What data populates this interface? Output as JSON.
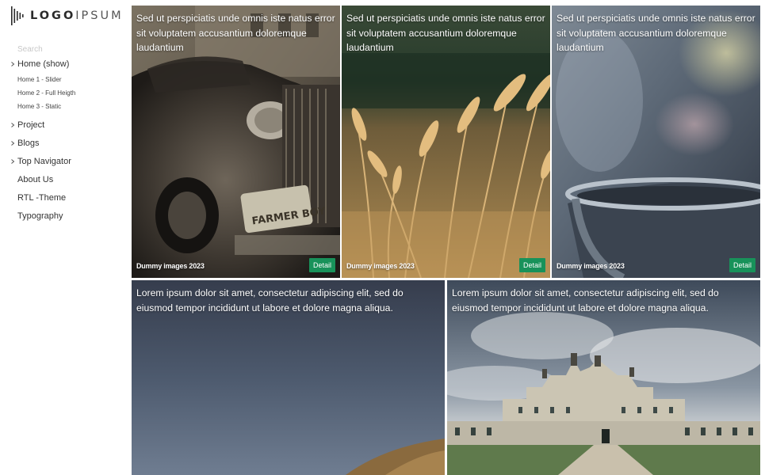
{
  "brand": {
    "logo_bold": "LOGO",
    "logo_light": "IPSUM"
  },
  "search": {
    "placeholder": "Search"
  },
  "sidebar": {
    "items": [
      {
        "label": "Home (show)",
        "has_children": true
      },
      {
        "label": "Home 1 - Slider",
        "sub": true
      },
      {
        "label": "Home 2 - Full Heigth",
        "sub": true
      },
      {
        "label": "Home 3 - Static",
        "sub": true
      },
      {
        "label": "Project",
        "has_children": true
      },
      {
        "label": "Blogs",
        "has_children": true
      },
      {
        "label": "Top Navigator",
        "has_children": true
      },
      {
        "label": "About Us",
        "has_children": false
      },
      {
        "label": "RTL -Theme",
        "has_children": false
      },
      {
        "label": "Typography",
        "has_children": false
      }
    ]
  },
  "tiles": [
    {
      "caption": "Sed ut perspiciatis unde omnis iste natus error sit voluptatem accusantium doloremque laudantium",
      "credit": "Dummy images 2023",
      "button": "Detail",
      "image": "vintage car"
    },
    {
      "caption": "Sed ut perspiciatis unde omnis iste natus error sit voluptatem accusantium doloremque laudantium",
      "credit": "Dummy images 2023",
      "button": "Detail",
      "image": "wheat field"
    },
    {
      "caption": "Sed ut perspiciatis unde omnis iste natus error sit voluptatem accusantium doloremque laudantium",
      "credit": "Dummy images 2023",
      "button": "Detail",
      "image": "steaming cup"
    },
    {
      "caption": "Lorem ipsum dolor sit amet, consectetur adipiscing elit, sed do eiusmod tempor incididunt ut labore et dolore magna aliqua.",
      "image": "sky and hill"
    },
    {
      "caption": "Lorem ipsum dolor sit amet, consectetur adipiscing elit, sed do eiusmod tempor incididunt ut labore et dolore magna aliqua.",
      "image": "chateau"
    }
  ],
  "colors": {
    "accent": "#18925a",
    "text": "#333333"
  }
}
